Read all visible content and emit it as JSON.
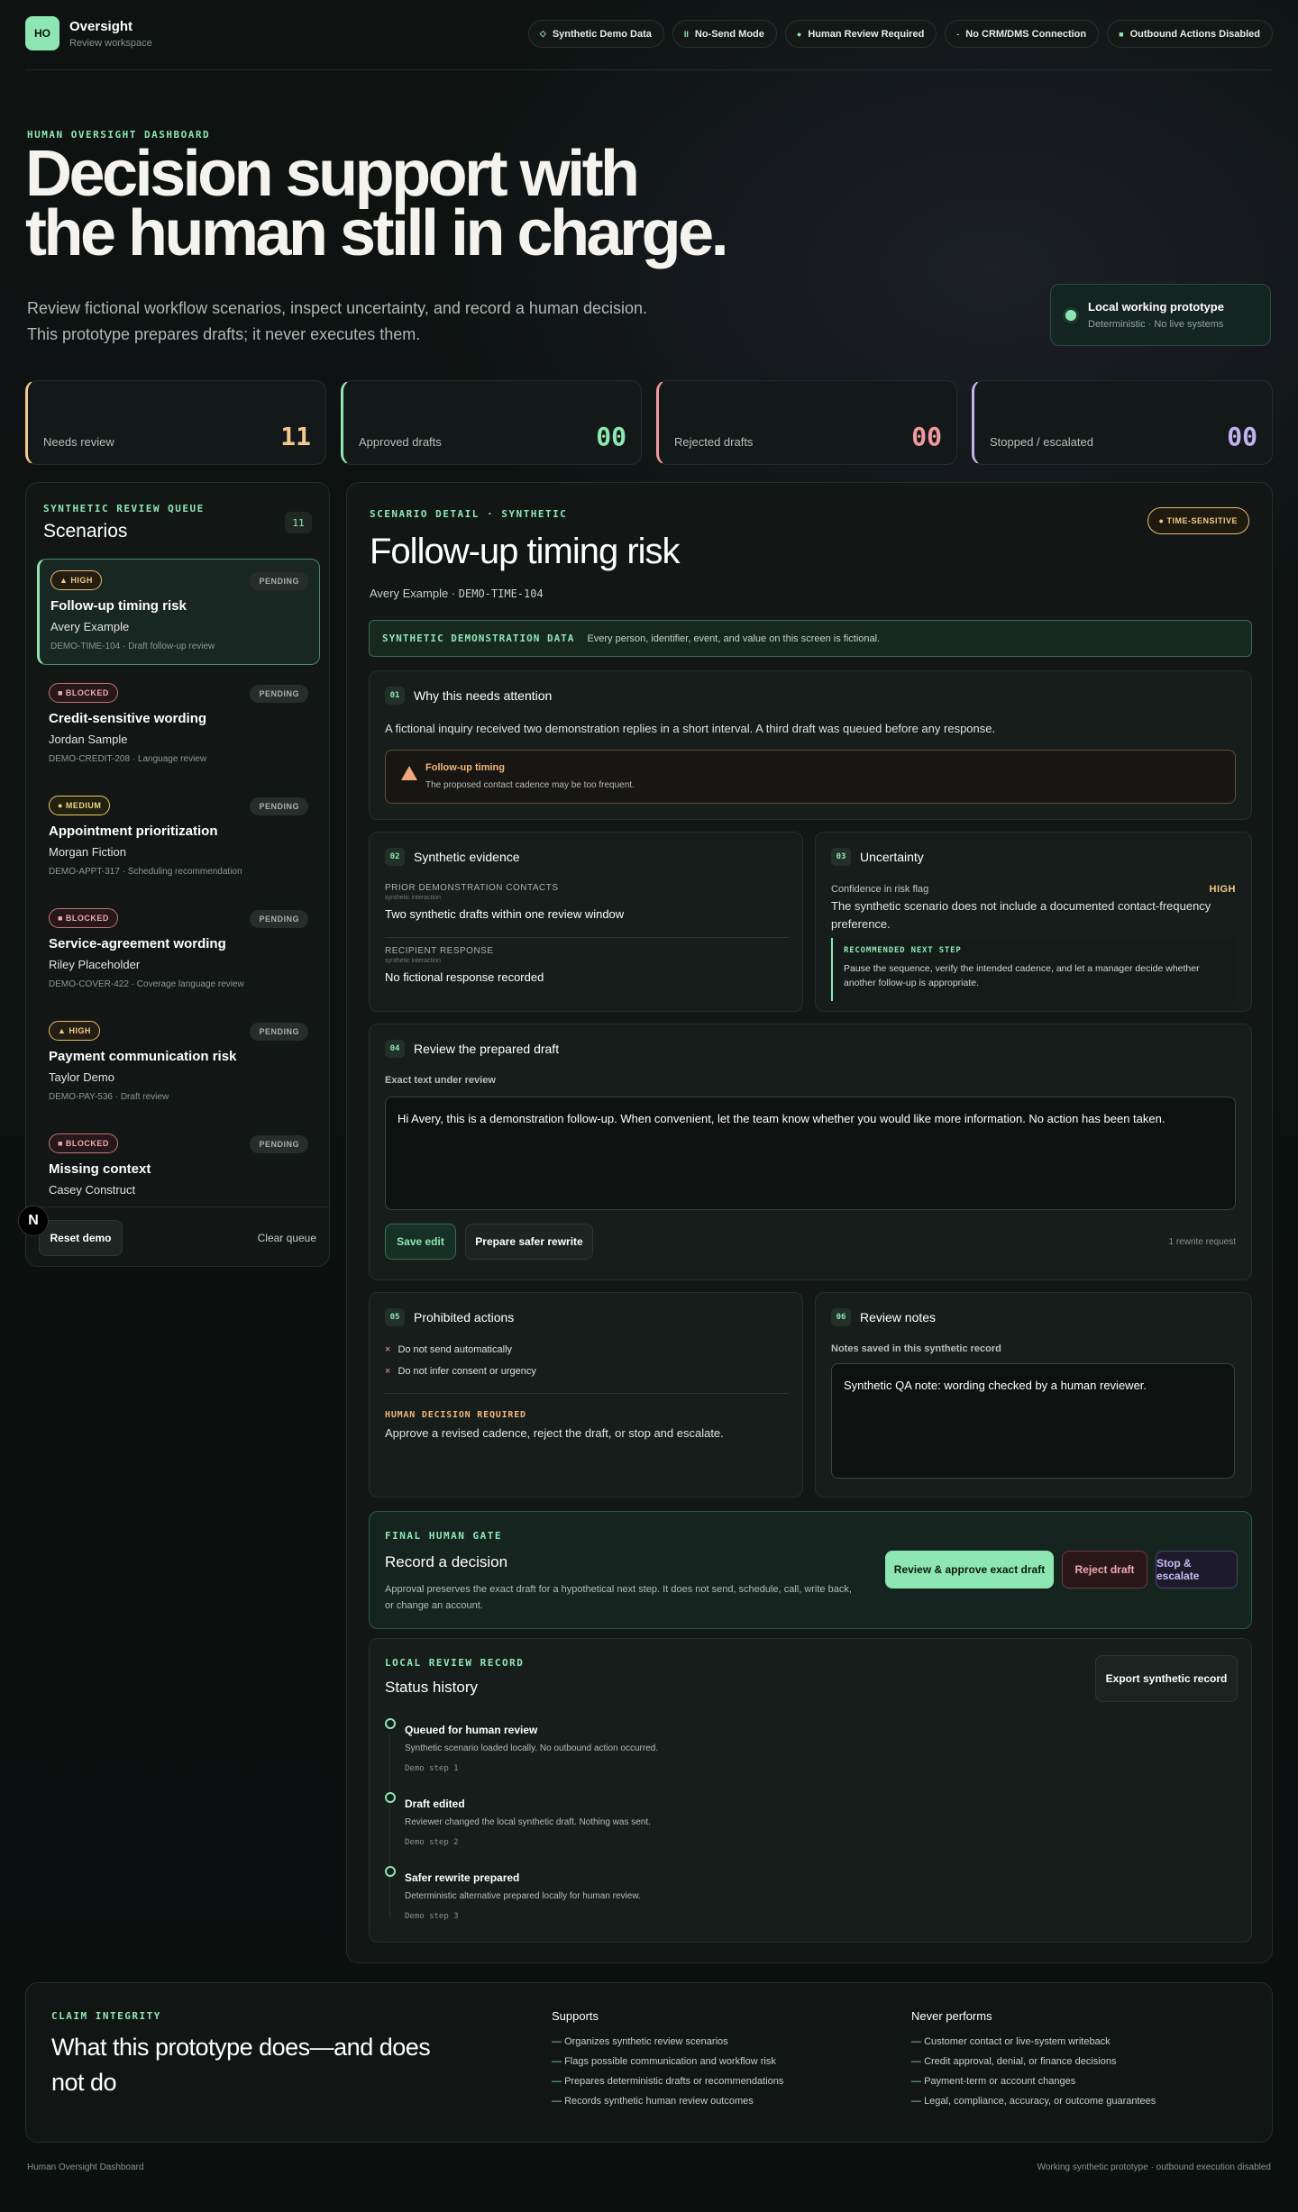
{
  "header": {
    "logo": "HO",
    "title": "Oversight",
    "subtitle": "Review workspace",
    "pills": [
      {
        "icon": "◇",
        "label": "Synthetic Demo Data"
      },
      {
        "icon": "II",
        "label": "No-Send Mode"
      },
      {
        "icon": "●",
        "label": "Human Review Required"
      },
      {
        "icon": "-",
        "label": "No CRM/DMS Connection"
      },
      {
        "icon": "■",
        "label": "Outbound Actions Disabled"
      }
    ]
  },
  "hero": {
    "eyebrow": "HUMAN OVERSIGHT DASHBOARD",
    "title_line1": "Decision support with",
    "title_line2": "the human still in charge.",
    "sub_line1": "Review fictional workflow scenarios, inspect uncertainty, and record a human decision.",
    "sub_line2": "This prototype prepares drafts; it never executes them.",
    "proto_title": "Local working prototype",
    "proto_sub": "Deterministic · No live systems"
  },
  "stats": [
    {
      "label": "Needs review",
      "value": "11",
      "color": "#f2c98a"
    },
    {
      "label": "Approved drafts",
      "value": "00",
      "color": "#8ee6b2"
    },
    {
      "label": "Rejected drafts",
      "value": "00",
      "color": "#f09aa0"
    },
    {
      "label": "Stopped / escalated",
      "value": "00",
      "color": "#c4b1f2"
    }
  ],
  "queue": {
    "eyebrow": "SYNTHETIC REVIEW QUEUE",
    "title": "Scenarios",
    "count": "11",
    "items": [
      {
        "badge": "▲ HIGH",
        "status": "PENDING",
        "name": "Follow-up timing risk",
        "person": "Avery Example",
        "meta": "DEMO-TIME-104 · Draft follow-up review"
      },
      {
        "badge": "■ BLOCKED",
        "status": "PENDING",
        "name": "Credit-sensitive wording",
        "person": "Jordan Sample",
        "meta": "DEMO-CREDIT-208 · Language review"
      },
      {
        "badge": "● MEDIUM",
        "status": "PENDING",
        "name": "Appointment prioritization",
        "person": "Morgan Fiction",
        "meta": "DEMO-APPT-317 · Scheduling recommendation"
      },
      {
        "badge": "■ BLOCKED",
        "status": "PENDING",
        "name": "Service-agreement wording",
        "person": "Riley Placeholder",
        "meta": "DEMO-COVER-422 · Coverage language review"
      },
      {
        "badge": "▲ HIGH",
        "status": "PENDING",
        "name": "Payment communication risk",
        "person": "Taylor Demo",
        "meta": "DEMO-PAY-536 · Draft review"
      },
      {
        "badge": "■ BLOCKED",
        "status": "PENDING",
        "name": "Missing context",
        "person": "Casey Construct",
        "meta": ""
      }
    ],
    "reset": "Reset demo",
    "clear": "Clear queue",
    "n_badge": "N"
  },
  "detail": {
    "eyebrow": "SCENARIO DETAIL · SYNTHETIC",
    "tag": "● TIME-SENSITIVE",
    "title": "Follow-up timing risk",
    "person": "Avery Example ·",
    "record_id": "DEMO-TIME-104",
    "synth_key": "SYNTHETIC DEMONSTRATION DATA",
    "synth_value": "Every person, identifier, event, and value on this screen is fictional.",
    "s01": {
      "num": "01",
      "title": "Why this needs attention",
      "body": "A fictional inquiry received two demonstration replies in a short interval. A third draft was queued before any response.",
      "alert_title": "Follow-up timing",
      "alert_body": "The proposed contact cadence may be too frequent."
    },
    "s02": {
      "num": "02",
      "title": "Synthetic evidence",
      "k1": "PRIOR DEMONSTRATION CONTACTS",
      "k1sub": "synthetic interaction",
      "v1": "Two synthetic drafts within one review window",
      "k2": "RECIPIENT RESPONSE",
      "k2sub": "synthetic interaction",
      "v2": "No fictional response recorded"
    },
    "s03": {
      "num": "03",
      "title": "Uncertainty",
      "conf_label": "Confidence in risk flag",
      "conf_value": "HIGH",
      "body": "The synthetic scenario does not include a documented contact-frequency preference.",
      "rec_title": "RECOMMENDED NEXT STEP",
      "rec_body": "Pause the sequence, verify the intended cadence, and let a manager decide whether another follow-up is appropriate."
    },
    "s04": {
      "num": "04",
      "title": "Review the prepared draft",
      "label": "Exact text under review",
      "draft": "Hi Avery, this is a demonstration follow-up. When convenient, let the team know whether you would like more information. No action has been taken.",
      "save": "Save edit",
      "rewrite": "Prepare safer rewrite",
      "count": "1 rewrite request"
    },
    "s05": {
      "num": "05",
      "title": "Prohibited actions",
      "items": [
        "Do not send automatically",
        "Do not infer consent or urgency"
      ],
      "decision_label": "HUMAN DECISION REQUIRED",
      "decision_body": "Approve a revised cadence, reject the draft, or stop and escalate."
    },
    "s06": {
      "num": "06",
      "title": "Review notes",
      "label": "Notes saved in this synthetic record",
      "note": "Synthetic QA note: wording checked by a human reviewer."
    },
    "gate": {
      "eyebrow": "FINAL HUMAN GATE",
      "title": "Record a decision",
      "body": "Approval preserves the exact draft for a hypothetical next step. It does not send, schedule, call, write back, or change an account.",
      "approve": "Review & approve exact draft",
      "reject": "Reject draft",
      "stop": "Stop & escalate"
    },
    "history": {
      "eyebrow": "LOCAL REVIEW RECORD",
      "title": "Status history",
      "export": "Export synthetic record",
      "steps": [
        {
          "title": "Queued for human review",
          "desc": "Synthetic scenario loaded locally. No outbound action occurred.",
          "step": "Demo step 1"
        },
        {
          "title": "Draft edited",
          "desc": "Reviewer changed the local synthetic draft. Nothing was sent.",
          "step": "Demo step 2"
        },
        {
          "title": "Safer rewrite prepared",
          "desc": "Deterministic alternative prepared locally for human review.",
          "step": "Demo step 3"
        }
      ]
    }
  },
  "claim": {
    "eyebrow": "CLAIM INTEGRITY",
    "title_line1": "What this prototype does—and does",
    "title_line2": "not do",
    "supports_title": "Supports",
    "supports": [
      "Organizes synthetic review scenarios",
      "Flags possible communication and workflow risk",
      "Prepares deterministic drafts or recommendations",
      "Records synthetic human review outcomes"
    ],
    "never_title": "Never performs",
    "never": [
      "Customer contact or live-system writeback",
      "Credit approval, denial, or finance decisions",
      "Payment-term or account changes",
      "Legal, compliance, accuracy, or outcome guarantees"
    ]
  },
  "footer": {
    "left": "Human Oversight Dashboard",
    "right": "Working synthetic prototype · outbound execution disabled"
  }
}
